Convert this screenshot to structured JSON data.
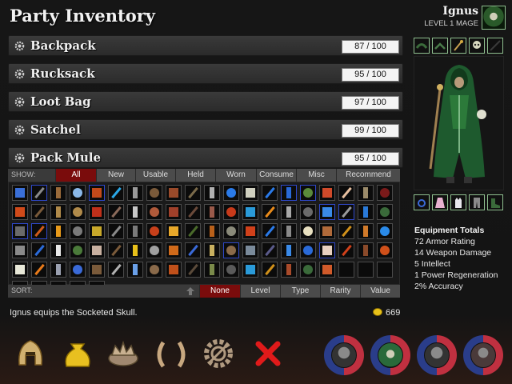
{
  "title": "Party Inventory",
  "bags": [
    {
      "name": "Backpack",
      "capacity": "87 / 100"
    },
    {
      "name": "Rucksack",
      "capacity": "95 / 100"
    },
    {
      "name": "Loot Bag",
      "capacity": "97 / 100"
    },
    {
      "name": "Satchel",
      "capacity": "99 / 100"
    },
    {
      "name": "Pack Mule",
      "capacity": "95 / 100"
    }
  ],
  "filter": {
    "label": "SHOW:",
    "tabs": [
      "All",
      "New",
      "Usable",
      "Held",
      "Worn",
      "Consume",
      "Misc",
      "Recommend"
    ],
    "active": "All"
  },
  "sort": {
    "label": "SORT:",
    "tabs": [
      "None",
      "Level",
      "Type",
      "Rarity",
      "Value"
    ],
    "active": "None"
  },
  "message": "Ignus equips the Socketed Skull.",
  "gold": "669",
  "hero": {
    "name": "Ignus",
    "level": "LEVEL 1 MAGE"
  },
  "equipment_totals": {
    "title": "Equipment Totals",
    "lines": [
      "72 Armor Rating",
      "14 Weapon Damage",
      "5 Intellect",
      "1 Power Regeneration",
      "2% Accuracy"
    ]
  },
  "icons": {
    "toolbar": [
      "helmet-icon",
      "loot-bag-icon",
      "crown-icon",
      "laurel-wreath-icon",
      "settings-gear-icon",
      "close-x-icon"
    ],
    "equipment_top": [
      "shoulder-armor-icon",
      "boots-icon",
      "wand-icon",
      "skull-icon",
      "empty-slot-icon"
    ],
    "equipment_bottom": [
      "ring-icon",
      "robe-icon",
      "gloves-icon",
      "leggings-icon",
      "boots-icon"
    ]
  },
  "colors": {
    "active_tab": "#7a0c0c",
    "slot_border": "#4a4a4a",
    "highlight_border": "#2f48c8",
    "equip_border": "#8fbf8f",
    "gold_coin": "#e8c21a"
  },
  "inventory_items": [
    "#3a6fd8",
    "#8a8a8a",
    "#9a6a3a",
    "#8ab8e8",
    "#c24a1a",
    "#2aa8e8",
    "#9a9a9a",
    "#7a5a3a",
    "#9a4a2a",
    "#7a6a4a",
    "#b0b0b0",
    "#2a7ae8",
    "#d0d0c0",
    "#2a7ae8",
    "#2a6ad8",
    "#5a8a3a",
    "#d04a2a",
    "#e8c0a0",
    "#9a8a6a",
    "#7a1a1a",
    "#d04a1a",
    "#7a5a3a",
    "#b08a4a",
    "#b08a4a",
    "#c0301a",
    "#8a6a5a",
    "#c8c8c8",
    "#b05a3a",
    "#a0402a",
    "#6a4a3a",
    "#9a5a4a",
    "#c83a1a",
    "#2a9ad8",
    "#e88a1a",
    "#a8a8a8",
    "#6a6a6a",
    "#3a8ae8",
    "#9a9a9a",
    "#2a7ad8",
    "#3a6a3a",
    "#6a6a6a",
    "#d05a1a",
    "#e89a1a",
    "#7a7a7a",
    "#c8a82a",
    "#8a8a8a",
    "#7a7a7a",
    "#c8401a",
    "#e8a82a",
    "#4a6a2a",
    "#b8601a",
    "#8a8a7a",
    "#d0401a",
    "#2a7ae8",
    "#8a8a8a",
    "#e8e0c0",
    "#b06a3a",
    "#d0901a",
    "#d07a2a",
    "#2a8ae8",
    "#8a8a8a",
    "#2a6ad8",
    "#e8e8e8",
    "#4a7a3a",
    "#c8b0a0",
    "#7a5a3a",
    "#e8c01a",
    "#a0a0a0",
    "#d06a1a",
    "#3a6ad8",
    "#c8b060",
    "#8a6a4a",
    "#7a8a9a",
    "#5a5a8a",
    "#3a8ae8",
    "#2a6ad8",
    "#e8d0c0",
    "#d0401a",
    "#8a4a2a",
    "#d0501a",
    "#e8e8d8",
    "#e87a1a",
    "#9aa0b0",
    "#3a6ad8",
    "#7a5a3a",
    "#b0b0b0",
    "#6aa0e8",
    "#8a6a4a",
    "#c0501a",
    "#5a4a3a",
    "#7a8a4a",
    "#5a5a5a",
    "#2a9ad8",
    "#d0901a",
    "#a84a2a",
    "#3a6a3a",
    "#d05a2a"
  ]
}
